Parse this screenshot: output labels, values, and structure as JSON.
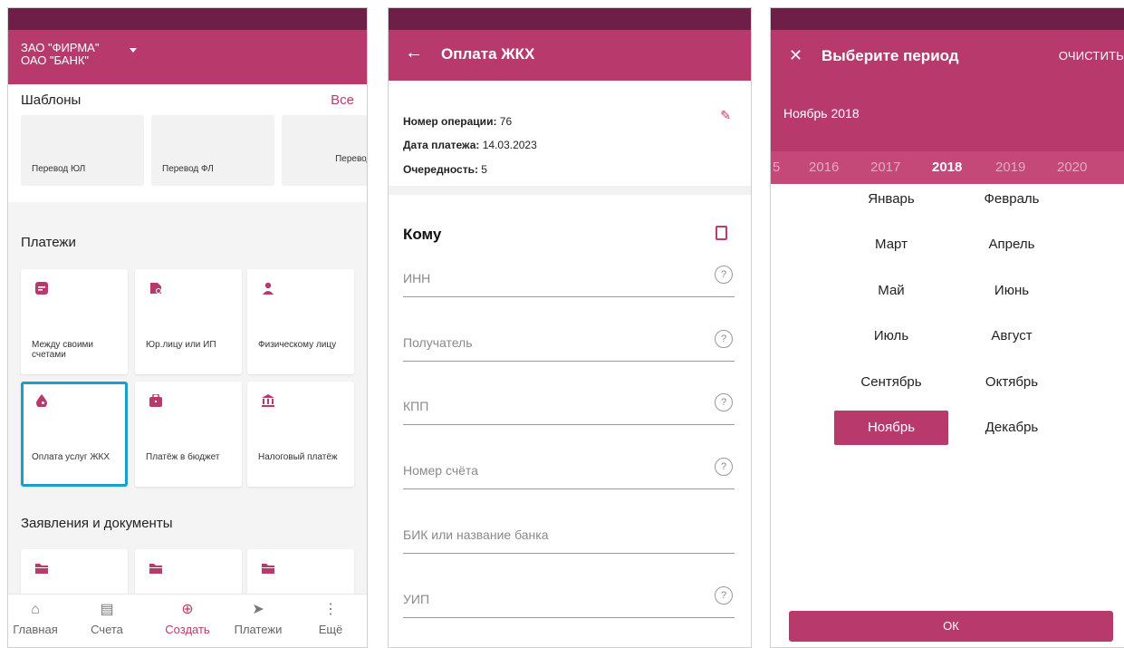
{
  "screen1": {
    "org_line1": "ЗАО \"ФИРМА\"",
    "org_line2": "ОАО \"БАНК\"",
    "templates_title": "Шаблоны",
    "templates_all": "Все",
    "templates": [
      "Перевод ЮЛ",
      "Перевод ФЛ",
      "Перевод между счетами"
    ],
    "payments_title": "Платежи",
    "payments": [
      "Между своими счетами",
      "Юр.лицу или ИП",
      "Физическому лицу",
      "Оплата услуг ЖКХ",
      "Платёж в бюджет",
      "Налоговый платёж"
    ],
    "documents_title": "Заявления и документы",
    "nav": [
      {
        "label": "Главная",
        "icon": "home-icon"
      },
      {
        "label": "Счета",
        "icon": "account-icon"
      },
      {
        "label": "Создать",
        "icon": "plus-circle-icon"
      },
      {
        "label": "Платежи",
        "icon": "send-icon"
      },
      {
        "label": "Ещё",
        "icon": "more-icon"
      }
    ]
  },
  "screen2": {
    "title": "Оплата ЖКХ",
    "op_label": "Номер операции:",
    "op_value": "76",
    "date_label": "Дата платежа:",
    "date_value": "14.03.2023",
    "order_label": "Очередность:",
    "order_value": "5",
    "section": "Кому",
    "fields": [
      "ИНН",
      "Получатель",
      "КПП",
      "Номер счёта",
      "БИК или название банка",
      "УИП"
    ]
  },
  "screen3": {
    "title": "Выберите период",
    "clear": "ОЧИСТИТЬ",
    "current": "Ноябрь 2018",
    "years": [
      "5",
      "2016",
      "2017",
      "2018",
      "2019",
      "2020"
    ],
    "selected_year": "2018",
    "months": [
      "Январь",
      "Февраль",
      "Март",
      "Апрель",
      "Май",
      "Июнь",
      "Июль",
      "Август",
      "Сентябрь",
      "Октябрь",
      "Ноябрь",
      "Декабрь"
    ],
    "selected_month": "Ноябрь",
    "ok": "ОК"
  },
  "colors": {
    "brand": "#b83a6d",
    "statusbar": "#6e1f47",
    "selection": "#1aa0c8"
  }
}
